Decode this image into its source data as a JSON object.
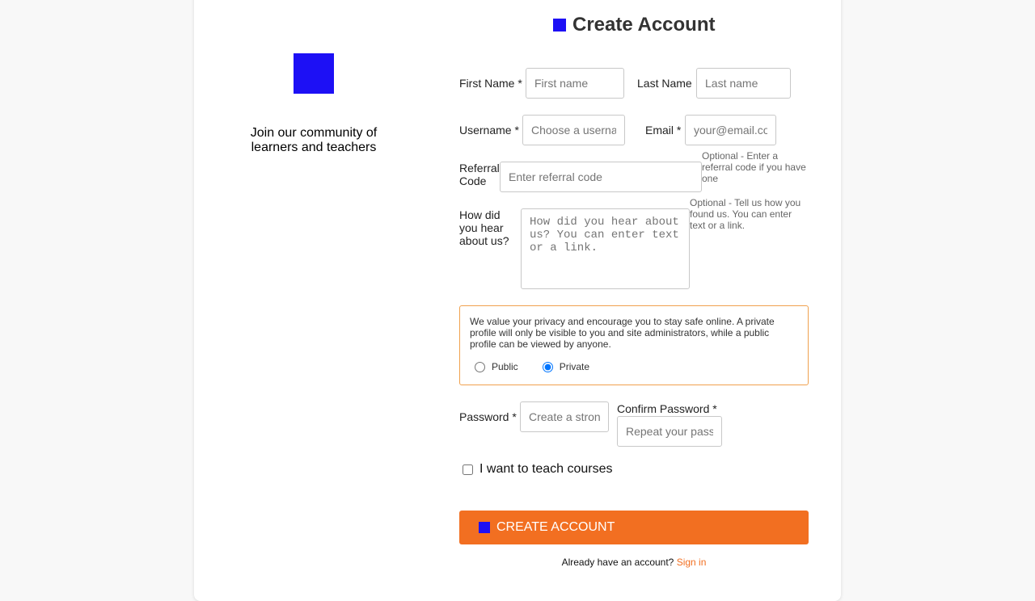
{
  "left_panel": {
    "tagline": "Join our community of learners and teachers"
  },
  "form": {
    "title": "Create Account",
    "first_name": {
      "label": "First Name *",
      "placeholder": "First name"
    },
    "last_name": {
      "label": "Last Name",
      "placeholder": "Last name"
    },
    "username": {
      "label": "Username *",
      "placeholder": "Choose a username"
    },
    "email": {
      "label": "Email *",
      "placeholder": "your@email.com"
    },
    "referral": {
      "label_line1": "Referral",
      "label_line2": "Code",
      "placeholder": "Enter referral code",
      "help": "Optional - Enter a referral code if you have one"
    },
    "hear_about": {
      "label": "How did you hear about us?",
      "placeholder": "How did you hear about us? You can enter text or a link.",
      "help": "Optional - Tell us how you found us. You can enter text or a link."
    },
    "privacy": {
      "message": "We value your privacy and encourage you to stay safe online. A private profile will only be visible to you and site administrators, while a public profile can be viewed by anyone.",
      "options": [
        "Public",
        "Private"
      ],
      "selected": "Private"
    },
    "password": {
      "label": "Password *",
      "placeholder": "Create a strong password"
    },
    "confirm_password": {
      "label": "Confirm Password *",
      "placeholder": "Repeat your password"
    },
    "teach_checkbox": {
      "label": "I want to teach courses",
      "checked": false
    },
    "submit_label": "CREATE ACCOUNT",
    "signin_prompt": "Already have an account?",
    "signin_link": "Sign in"
  },
  "colors": {
    "accent": "#f26f21",
    "logo": "#1d10f5",
    "privacy_border": "#f0a14e"
  },
  "icons": {
    "logo": "logo-square-icon",
    "title": "brand-square-icon",
    "submit": "brand-square-icon"
  }
}
